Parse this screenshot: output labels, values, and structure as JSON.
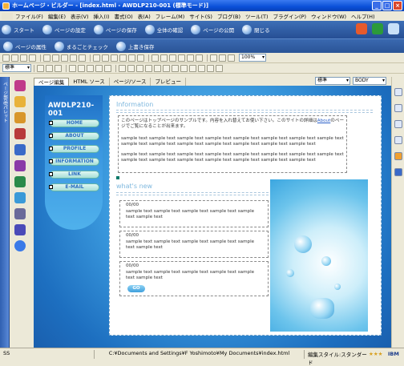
{
  "window": {
    "title": "ホームページ・ビルダー - [index.html - AWDLP210-001 (標準モード)]"
  },
  "menu": [
    "ファイル(F)",
    "編集(E)",
    "表示(V)",
    "挿入(I)",
    "書式(O)",
    "表(A)",
    "フレーム(M)",
    "サイト(S)",
    "ブログ(B)",
    "ツール(T)",
    "プラグイン(P)",
    "ウィンドウ(W)",
    "ヘルプ(H)"
  ],
  "quickbar": {
    "start": "スタート",
    "page_settings": "ページの設定",
    "save_page": "ページの保存",
    "check_all": "全体の確認",
    "publish": "ページの公開",
    "close": "閉じる"
  },
  "quickbar2": {
    "page_props": "ページの属性",
    "full_check": "まるごとチェック",
    "overwrite_save": "上書き保存"
  },
  "toolbar": {
    "zoom": "100%",
    "style": "標準",
    "standard": "標準",
    "body": "BODY"
  },
  "tabs": [
    "ページ編集",
    "HTML ソース",
    "ページ/ソース",
    "プレビュー"
  ],
  "left_strip_label": "ページ部品/パレット",
  "site": {
    "logo": "AWDLP210-001",
    "nav": [
      "HOME",
      "ABOUT",
      "PROFILE",
      "INFORMATION",
      "LINK",
      "E-MAIL"
    ],
    "info_heading": "Information",
    "info_text1": "このページはトップページのサンプルです。内容を入れ替えてお使い下さい。このサイトの詳細は",
    "info_link": "About",
    "info_text2": "のページでご覧になることが出来ます。",
    "sample_text": "sample text sample text sample text sample text sample text sample text sample text sample text sample text sample text sample text sample text sample text sample text sample text",
    "whats_heading": "what's new",
    "news": [
      {
        "date": "00/00",
        "text": "sample text sample text sample text sample text sample text sample text"
      },
      {
        "date": "00/00",
        "text": "sample text sample text sample text sample text sample text sample text"
      },
      {
        "date": "00/00",
        "text": "sample text sample text sample text sample text sample text sample text"
      }
    ],
    "go": "GO"
  },
  "status": {
    "left": "SS",
    "path": "C:¥Documents and Settings¥F Yoshimoto¥My Documents¥index.html",
    "mode": "編集スタイル:スタンダード",
    "brand": "IBM"
  }
}
